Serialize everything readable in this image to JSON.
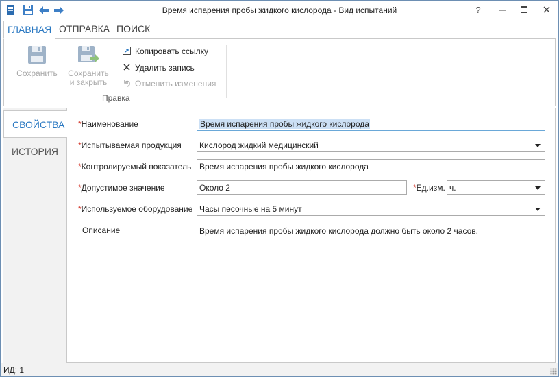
{
  "window": {
    "title": "Время испарения пробы жидкого кислорода - Вид испытаний",
    "help": "?",
    "minimize": "—",
    "maximize": "☐",
    "close": "✕"
  },
  "quick_access": [
    "app-icon",
    "save-icon",
    "back-arrow-icon",
    "forward-arrow-icon"
  ],
  "ribbon": {
    "tabs": [
      "ГЛАВНАЯ",
      "ОТПРАВКА",
      "ПОИСК"
    ],
    "active_tab": "ГЛАВНАЯ",
    "save_label": "Сохранить",
    "save_close_label_1": "Сохранить",
    "save_close_label_2": "и закрыть",
    "copy_link_label": "Копировать ссылку",
    "delete_label": "Удалить запись",
    "undo_label": "Отменить изменения",
    "group_label": "Правка"
  },
  "side_tabs": {
    "properties": "СВОЙСТВА",
    "history": "ИСТОРИЯ"
  },
  "form": {
    "required_mark": "*",
    "name_label": "Наименование",
    "name_value": "Время испарения пробы жидкого кислорода",
    "product_label": "Испытываемая продукция",
    "product_value": "Кислород жидкий медицинский",
    "indicator_label": "Контролируемый показатель",
    "indicator_value": "Время испарения пробы жидкого кислорода",
    "allowed_label": "Допустимое значение",
    "allowed_value": "Около 2",
    "unit_label": "Ед.изм.",
    "unit_value": "ч.",
    "equipment_label": "Используемое оборудование",
    "equipment_value": "Часы песочные на 5 минут",
    "description_label": "Описание",
    "description_value": "Время испарения пробы жидкого кислорода должно быть около 2 часов."
  },
  "status": {
    "id_text": "ИД: 1"
  },
  "colors": {
    "accent": "#2b79c2",
    "required": "#d4382c",
    "disabled": "#a8a8a8",
    "selection": "#cce0f5"
  }
}
